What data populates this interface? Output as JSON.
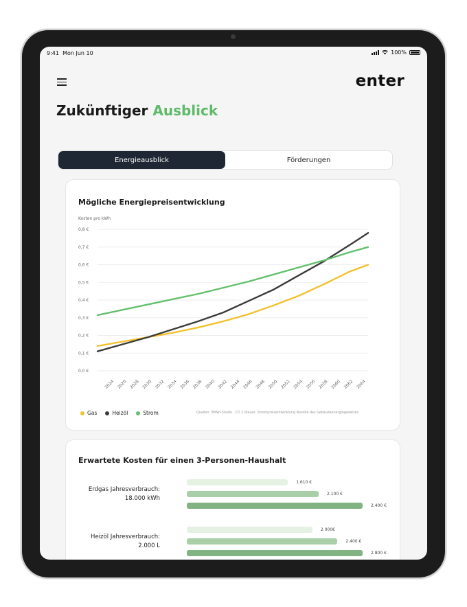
{
  "status": {
    "time": "9:41",
    "date": "Mon Jun 10",
    "battery": "100%"
  },
  "header": {
    "logo": "enter",
    "menu_icon": "hamburger-menu-icon"
  },
  "title": {
    "prefix": "Zukünftiger",
    "accent": "Ausblick",
    "accent_color": "#5fba6a"
  },
  "tabs": [
    {
      "label": "Energieausblick",
      "active": true
    },
    {
      "label": "Förderungen",
      "active": false
    }
  ],
  "chart_card": {
    "title": "Mögliche Energiepreisentwicklung",
    "source": "Quellen: BMWi-Studie , CO 1-Steuer, Strompreisentwicklung Novelle des Gebäudeenergiegesetzes"
  },
  "chart_data": {
    "type": "line",
    "ylabel": "Kosten pro kWh",
    "y_ticks": [
      "0,0 €",
      "0,1 €",
      "0,2 €",
      "0,3 €",
      "0,4 €",
      "0,5 €",
      "0,6 €",
      "0,7 €",
      "0,8 €"
    ],
    "ylim": [
      0,
      0.8
    ],
    "xlim": [
      2022,
      2065
    ],
    "x_ticks": [
      "2024",
      "2026",
      "2028",
      "2030",
      "2032",
      "2034",
      "2036",
      "2038",
      "2040",
      "2042",
      "2044",
      "2046",
      "2048",
      "2050",
      "2052",
      "2054",
      "2056",
      "2058",
      "2060",
      "2062",
      "2064"
    ],
    "grid": true,
    "legend_position": "bottom-left",
    "series": [
      {
        "name": "Gas",
        "color": "#f2c12e",
        "x": [
          2022,
          2026,
          2030,
          2034,
          2038,
          2042,
          2046,
          2050,
          2054,
          2058,
          2062,
          2065
        ],
        "y": [
          0.14,
          0.165,
          0.19,
          0.215,
          0.245,
          0.28,
          0.32,
          0.37,
          0.425,
          0.49,
          0.56,
          0.6
        ]
      },
      {
        "name": "Heizöl",
        "color": "#3b3b3b",
        "x": [
          2022,
          2026,
          2030,
          2034,
          2038,
          2042,
          2046,
          2050,
          2054,
          2058,
          2062,
          2065
        ],
        "y": [
          0.11,
          0.15,
          0.19,
          0.235,
          0.28,
          0.33,
          0.395,
          0.46,
          0.54,
          0.62,
          0.71,
          0.78
        ]
      },
      {
        "name": "Strom",
        "color": "#63c06e",
        "x": [
          2022,
          2026,
          2030,
          2034,
          2038,
          2042,
          2046,
          2050,
          2054,
          2058,
          2062,
          2065
        ],
        "y": [
          0.315,
          0.345,
          0.375,
          0.405,
          0.435,
          0.47,
          0.505,
          0.545,
          0.585,
          0.625,
          0.67,
          0.7
        ]
      }
    ]
  },
  "cost_card": {
    "title": "Erwartete Kosten für einen 3-Personen-Haushalt",
    "max_value": 2800,
    "groups": [
      {
        "label_line1": "Erdgas Jahresverbrauch:",
        "label_line2": "18.000 kWh",
        "bars": [
          {
            "value": 1610,
            "label": "1.610 €",
            "color": "#e4f1e3"
          },
          {
            "value": 2100,
            "label": "2.100 €",
            "color": "#a8cfa7"
          },
          {
            "value": 2800,
            "label": "2.400 €",
            "color": "#82b383"
          }
        ]
      },
      {
        "label_line1": "Heizöl Jahresverbrauch:",
        "label_line2": "2.000 L",
        "bars": [
          {
            "value": 2000,
            "label": "2.000€",
            "color": "#e4f1e3"
          },
          {
            "value": 2400,
            "label": "2.400 €",
            "color": "#a8cfa7"
          },
          {
            "value": 3200,
            "label": "2.800 €",
            "color": "#82b383"
          }
        ]
      }
    ]
  }
}
